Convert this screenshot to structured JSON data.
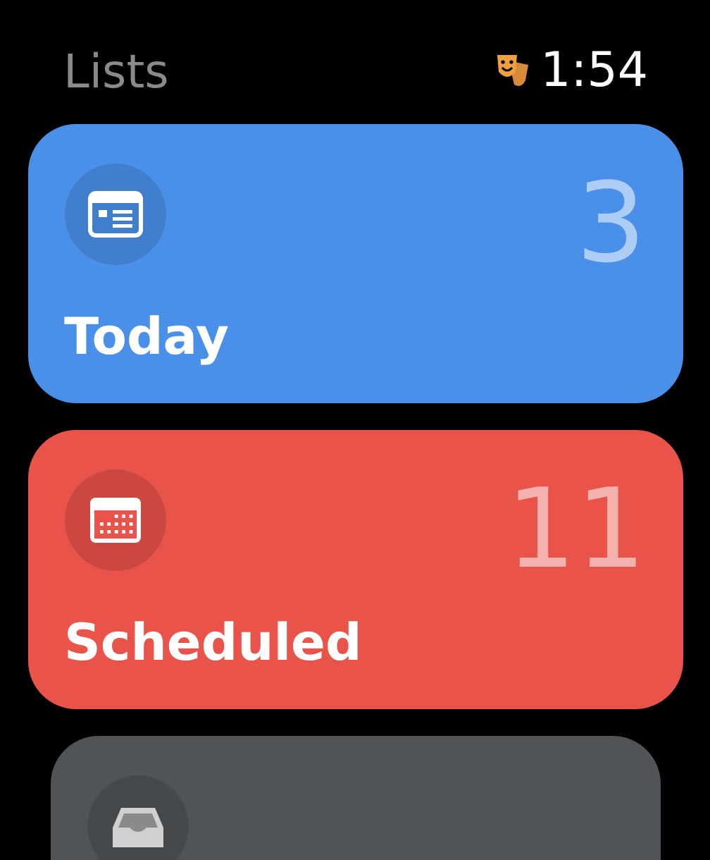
{
  "header": {
    "title": "Lists",
    "time": "1:54"
  },
  "lists": [
    {
      "kind": "calendar-card",
      "name": "Today",
      "count": "3",
      "color": "#4a90e8"
    },
    {
      "kind": "calendar-grid",
      "name": "Scheduled",
      "count": "11",
      "color": "#e8534a"
    },
    {
      "kind": "tray",
      "color": "#505457"
    }
  ]
}
